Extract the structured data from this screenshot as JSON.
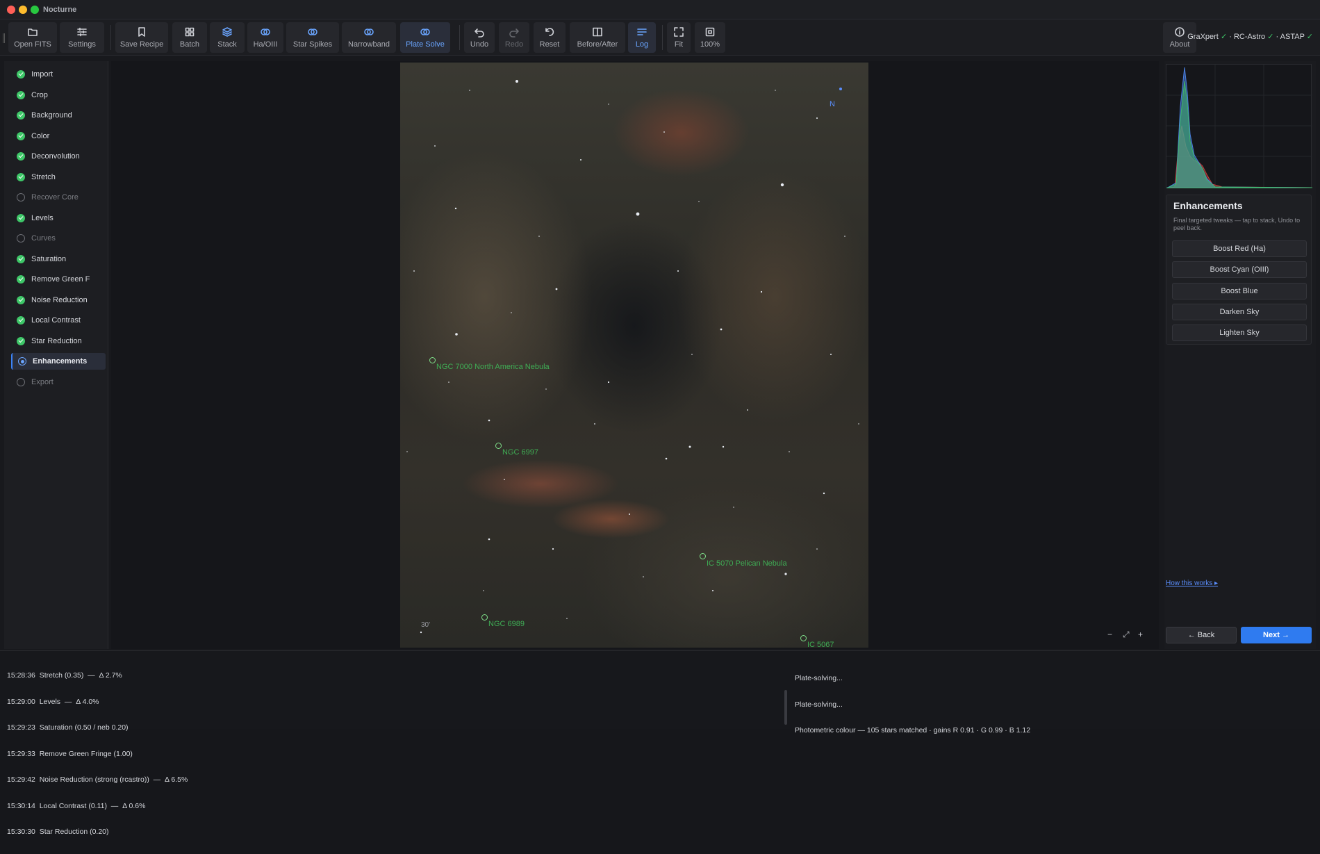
{
  "app": {
    "title": "Nocturne"
  },
  "toolbar": {
    "buttons": [
      {
        "label": "Open FITS",
        "icon": "folder-icon"
      },
      {
        "label": "Settings",
        "icon": "sliders-icon"
      },
      {
        "label": "Save Recipe",
        "icon": "bookmark-icon"
      },
      {
        "label": "Batch",
        "icon": "grid-icon"
      },
      {
        "label": "Stack",
        "icon": "layers-icon"
      },
      {
        "label": "Ha/OIII",
        "icon": "rings-icon"
      },
      {
        "label": "Star Spikes",
        "icon": "rings-icon"
      },
      {
        "label": "Narrowband",
        "icon": "rings-icon"
      },
      {
        "label": "Plate Solve",
        "icon": "rings-icon"
      },
      {
        "label": "Undo",
        "icon": "undo-icon"
      },
      {
        "label": "Redo",
        "icon": "redo-icon"
      },
      {
        "label": "Reset",
        "icon": "reset-icon"
      },
      {
        "label": "Before/After",
        "icon": "split-icon"
      },
      {
        "label": "Log",
        "icon": "lines-icon"
      },
      {
        "label": "Fit",
        "icon": "fit-icon"
      },
      {
        "label": "100%",
        "icon": "zoom100-icon"
      },
      {
        "label": "About",
        "icon": "info-icon"
      }
    ],
    "deps": [
      {
        "name": "GraXpert",
        "status": "✓"
      },
      {
        "name": "RC-Astro",
        "status": "✓"
      },
      {
        "name": "ASTAP",
        "status": "✓"
      }
    ],
    "deps_separator": "·"
  },
  "sidebar": {
    "steps": [
      {
        "label": "Import",
        "state": "done"
      },
      {
        "label": "Crop",
        "state": "done"
      },
      {
        "label": "Background",
        "state": "done"
      },
      {
        "label": "Color",
        "state": "done"
      },
      {
        "label": "Deconvolution",
        "state": "done"
      },
      {
        "label": "Stretch",
        "state": "done"
      },
      {
        "label": "Recover Core",
        "state": "pending"
      },
      {
        "label": "Levels",
        "state": "done"
      },
      {
        "label": "Curves",
        "state": "pending"
      },
      {
        "label": "Saturation",
        "state": "done"
      },
      {
        "label": "Remove Green F",
        "state": "done"
      },
      {
        "label": "Noise Reduction",
        "state": "done"
      },
      {
        "label": "Local Contrast",
        "state": "done"
      },
      {
        "label": "Star Reduction",
        "state": "done"
      },
      {
        "label": "Enhancements",
        "state": "current"
      },
      {
        "label": "Export",
        "state": "pending"
      }
    ]
  },
  "canvas": {
    "annotations": [
      {
        "label": "NGC 7000  North America Nebula"
      },
      {
        "label": "NGC 6997"
      },
      {
        "label": "IC 5070  Pelican Nebula"
      },
      {
        "label": "NGC 6989"
      },
      {
        "label": "IC 5067"
      }
    ],
    "compass_label": "N",
    "scale_label": "30'",
    "zoom_out": "−",
    "zoom_fit": "⤢",
    "zoom_in": "+"
  },
  "histogram": {
    "colors": {
      "red": "#c0413b",
      "green": "#3fb36b",
      "blue": "#4a7fe0"
    }
  },
  "enhancements": {
    "title": "Enhancements",
    "description": "Final targeted tweaks — tap to stack, Undo to peel back.",
    "buttons": [
      "Boost Red (Ha)",
      "Boost Cyan (OIII)",
      "Boost Blue",
      "Darken Sky",
      "Lighten Sky"
    ]
  },
  "footer": {
    "how_link": "How this works ▸",
    "back": "← Back",
    "next": "Next →"
  },
  "log": {
    "left": [
      "15:28:36  Stretch (0.35)  —  Δ 2.7%",
      "15:29:00  Levels  —  Δ 4.0%",
      "15:29:23  Saturation (0.50 / neb 0.20)",
      "15:29:33  Remove Green Fringe (1.00)",
      "15:29:42  Noise Reduction (strong (rcastro))  —  Δ 6.5%",
      "15:30:14  Local Contrast (0.11)  —  Δ 0.6%",
      "15:30:30  Star Reduction (0.20)"
    ],
    "right": [
      "Plate-solving...",
      "Plate-solving...",
      "Photometric colour — 105 stars matched · gains R 0.91 · G 0.99 · B 1.12"
    ]
  }
}
